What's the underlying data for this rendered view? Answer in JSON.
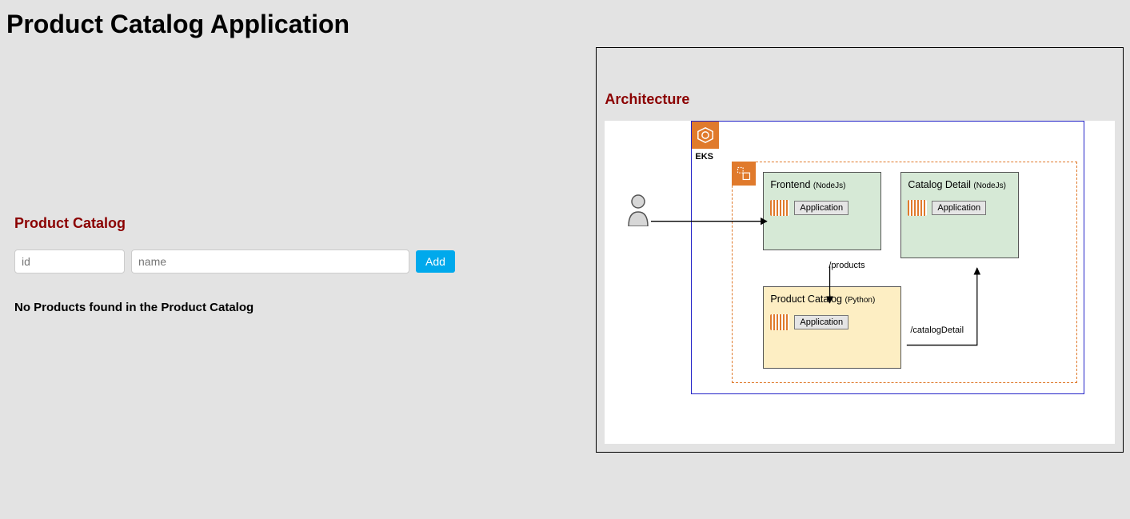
{
  "page": {
    "title": "Product Catalog Application"
  },
  "catalog": {
    "section_title": "Product Catalog",
    "id_placeholder": "id",
    "name_placeholder": "name",
    "add_label": "Add",
    "empty_message": "No Products found in the Product Catalog"
  },
  "architecture": {
    "title": "Architecture",
    "cluster_label": "EKS",
    "services": {
      "frontend": {
        "name": "Frontend",
        "tech": "(NodeJs)",
        "badge": "Application"
      },
      "detail": {
        "name": "Catalog Detail",
        "tech": "(NodeJs)",
        "badge": "Application"
      },
      "catalog": {
        "name": "Product Catalog",
        "tech": "(Python)",
        "badge": "Application"
      }
    },
    "edges": {
      "frontend_to_catalog": "/products",
      "catalog_to_detail": "/catalogDetail"
    }
  }
}
